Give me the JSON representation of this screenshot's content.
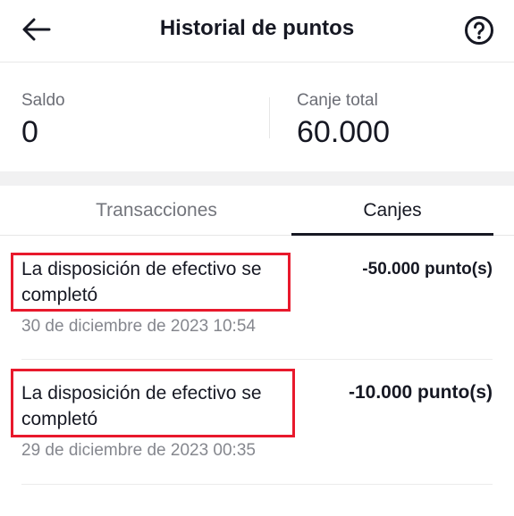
{
  "header": {
    "title": "Historial de puntos",
    "back_icon": "arrow-left-icon",
    "help_icon": "question-circle-icon"
  },
  "stats": {
    "balance_label": "Saldo",
    "balance_value": "0",
    "total_label": "Canje total",
    "total_value": "60.000"
  },
  "tabs": [
    {
      "label": "Transacciones",
      "active": false
    },
    {
      "label": "Canjes",
      "active": true
    }
  ],
  "items": [
    {
      "title_line1": "La disposición de efectivo se",
      "title_line2": "completó",
      "date": "30 de diciembre de 2023 10:54",
      "amount": "-50.000 punto(s)"
    },
    {
      "title_line1": "La disposición de efectivo se",
      "title_line2": "completó",
      "date": "29 de diciembre de 2023 00:35",
      "amount": "-10.000 punto(s)"
    }
  ],
  "colors": {
    "highlight": "#e8192c",
    "text": "#161823",
    "muted": "#85878e"
  }
}
